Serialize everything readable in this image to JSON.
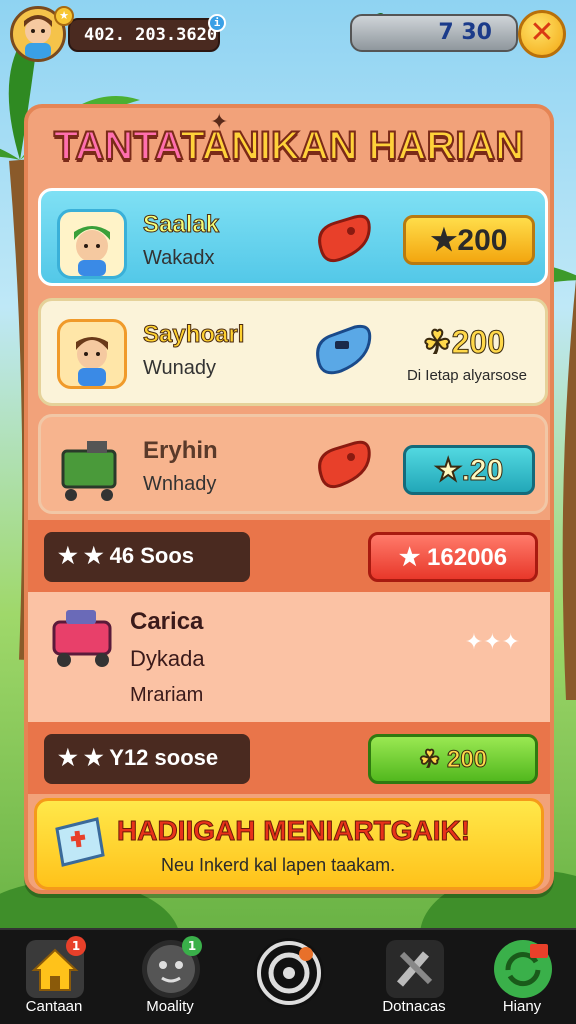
{
  "header": {
    "player_id": "402. 203.3620",
    "cash_amount": "7 30",
    "level_badge": "★"
  },
  "panel": {
    "title_part1": "TANTA",
    "title_part2": "TANIKAN HARIAN"
  },
  "tasks": [
    {
      "name": "Saalak",
      "sub": "Wakadx",
      "reward": "★200",
      "icon": "boy-avatar-icon"
    },
    {
      "name": "Sayhoarl",
      "sub": "Wunady",
      "reward": "☘200",
      "note": "Di Ietap alyarsose",
      "icon": "boy-avatar-icon"
    },
    {
      "name": "Eryhin",
      "sub": "Wnhady",
      "reward": "★.20",
      "icon": "cart-icon"
    }
  ],
  "bars": [
    {
      "left": "★ ★ 46 Soos",
      "right": "★ 162006"
    },
    {
      "left": "★ ★ Y12 soose",
      "right": "☘ 200"
    }
  ],
  "task_big": {
    "name": "Carica",
    "sub": "Dykada",
    "sub2": "Mrariam",
    "dots": "✦✦✦"
  },
  "banner": {
    "heading": "HADIIGAH MENIARTGAIK!",
    "description": "Neu Inkerd kal lapen taakam."
  },
  "nav": [
    {
      "label": "Cantaan",
      "badge": "1",
      "icon": "home-icon"
    },
    {
      "label": "Moality",
      "badge": "1",
      "icon": "face-icon"
    },
    {
      "label": "",
      "badge": "",
      "icon": "target-icon"
    },
    {
      "label": "Dotnacas",
      "badge": "",
      "icon": "tools-icon"
    },
    {
      "label": "Hiany",
      "badge": "",
      "icon": "refresh-icon"
    }
  ],
  "colors": {
    "panel": "#f2a27a",
    "title_yellow": "#ffd23a",
    "title_pink": "#ff6fae",
    "nav_bg": "#151515"
  }
}
